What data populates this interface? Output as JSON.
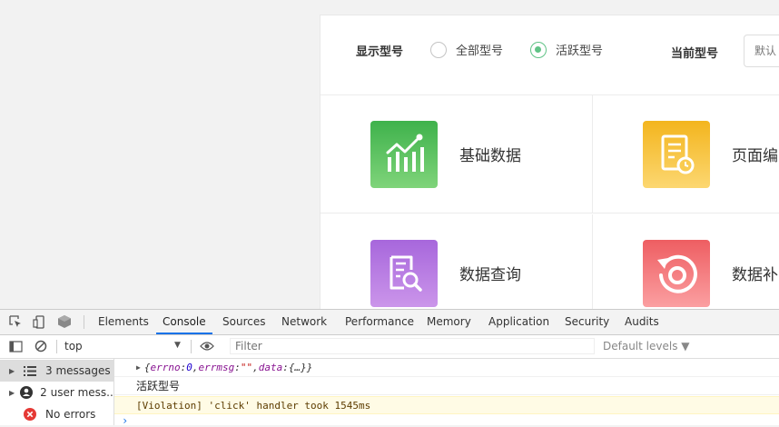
{
  "model_bar": {
    "display_label": "显示型号",
    "options": [
      {
        "label": "全部型号",
        "checked": false
      },
      {
        "label": "活跃型号",
        "checked": true
      }
    ],
    "current_label": "当前型号",
    "current_placeholder": "默认"
  },
  "modules": [
    {
      "label": "基础数据",
      "icon": "chart-line-icon",
      "color": "#4cbf5a"
    },
    {
      "label": "页面编",
      "icon": "document-clock-icon",
      "color": "#f7c23a"
    },
    {
      "label": "数据查询",
      "icon": "document-search-icon",
      "color": "#b87ae3"
    },
    {
      "label": "数据补",
      "icon": "refresh-icon",
      "color": "#f27478"
    }
  ],
  "devtools": {
    "tabs": [
      "Elements",
      "Console",
      "Sources",
      "Network",
      "Performance",
      "Memory",
      "Application",
      "Security",
      "Audits"
    ],
    "active_tab": "Console",
    "context": "top",
    "filter_placeholder": "Filter",
    "levels": "Default levels ▼",
    "sidebar": [
      {
        "label": "3 messages",
        "icon": "list-icon",
        "selected": true
      },
      {
        "label": "2 user mess...",
        "icon": "user-icon",
        "selected": false
      },
      {
        "label": "No errors",
        "icon": "error-icon",
        "selected": false
      }
    ],
    "console": {
      "obj_open": "{",
      "errno_key": "errno",
      "errno_val": "0",
      "errmsg_key": "errmsg",
      "errmsg_val": "\"\"",
      "data_key": "data",
      "data_val": "{…}",
      "obj_close": "}",
      "log_text": "活跃型号",
      "violation": "[Violation] 'click' handler took 1545ms",
      "prompt": "›"
    }
  }
}
